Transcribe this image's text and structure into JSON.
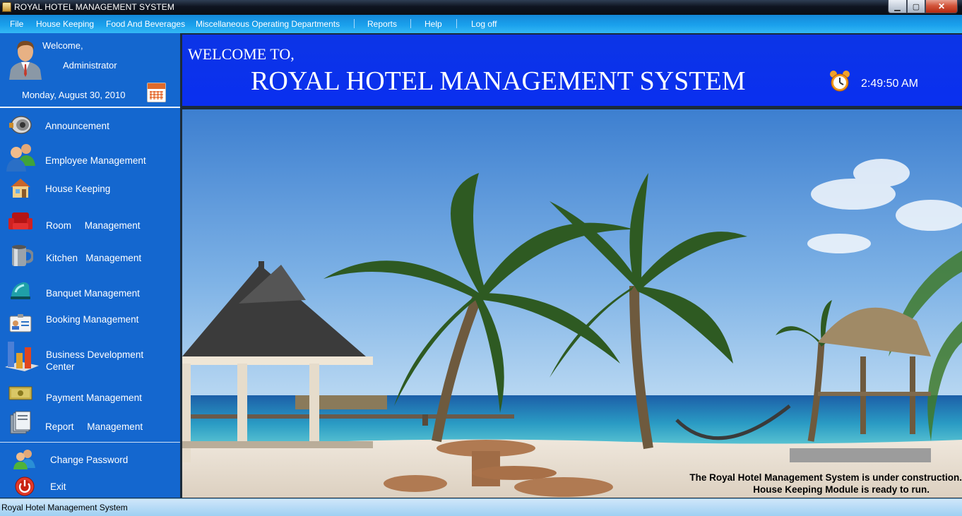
{
  "window": {
    "title": "ROYAL HOTEL MANAGEMENT SYSTEM",
    "minimize_glyph": "▁",
    "maximize_glyph": "▢",
    "close_glyph": "✕"
  },
  "menu": {
    "items": [
      "File",
      "House Keeping",
      "Food And Beverages",
      "Miscellaneous Operating Departments",
      "Reports",
      "Help",
      "Log off"
    ]
  },
  "user_panel": {
    "greeting": "Welcome,",
    "username": "Administrator",
    "date": "Monday, August 30, 2010"
  },
  "sidebar": {
    "items": [
      {
        "label": "Announcement",
        "icon": "megaphone-icon"
      },
      {
        "label": "Employee Management",
        "icon": "users-icon"
      },
      {
        "label": "House Keeping",
        "icon": "house-icon"
      },
      {
        "label": "Room     Management",
        "icon": "armchair-icon"
      },
      {
        "label": "Kitchen   Management",
        "icon": "mug-icon"
      },
      {
        "label": "Banquet Management",
        "icon": "iron-icon"
      },
      {
        "label": "Booking Management",
        "icon": "id-card-icon"
      },
      {
        "label": "Business Development",
        "label2": "Center",
        "icon": "bar-chart-icon"
      },
      {
        "label": "Payment Management",
        "icon": "cash-icon"
      },
      {
        "label": "Report     Management",
        "icon": "books-icon"
      }
    ],
    "bottom": [
      {
        "label": "Change Password",
        "icon": "users-key-icon"
      },
      {
        "label": "Exit",
        "icon": "power-icon"
      }
    ]
  },
  "header": {
    "welcome": "WELCOME TO,",
    "system_name": "ROYAL HOTEL MANAGEMENT SYSTEM",
    "time": "2:49:50 AM"
  },
  "notice": {
    "line1": "The Royal Hotel Management System is under construction.",
    "line2": "House Keeping Module is ready to run."
  },
  "status_bar": {
    "text": "Royal Hotel Management System"
  },
  "colors": {
    "sidebar": "#1467cf",
    "header": "#0a2ff0",
    "menubar": "#1aa0ec"
  }
}
